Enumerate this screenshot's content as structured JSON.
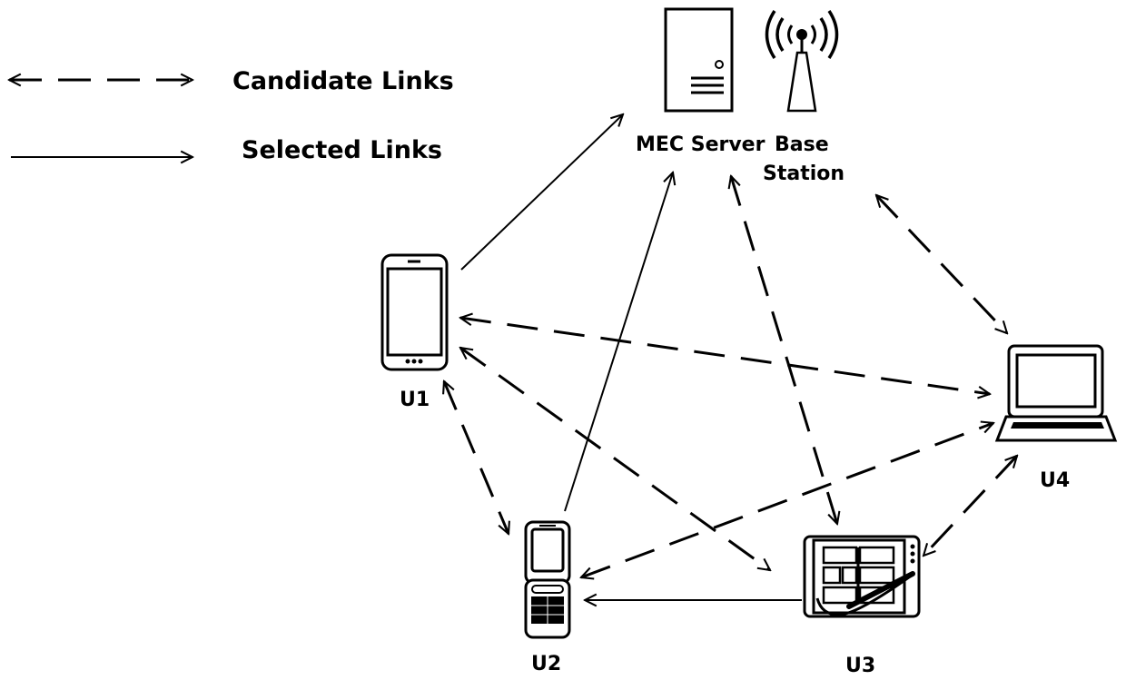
{
  "legend": {
    "candidate_label": "Candidate Links",
    "selected_label": "Selected Links"
  },
  "nodes": {
    "mec_server": {
      "label": "MEC Server",
      "icon": "server-icon"
    },
    "base_station": {
      "label_line1": "Base",
      "label_line2": "Station",
      "icon": "antenna-tower-icon"
    },
    "u1": {
      "label": "U1",
      "icon": "smartphone-icon"
    },
    "u2": {
      "label": "U2",
      "icon": "flip-phone-icon"
    },
    "u3": {
      "label": "U3",
      "icon": "tablet-stylus-icon"
    },
    "u4": {
      "label": "U4",
      "icon": "laptop-icon"
    }
  },
  "links": [
    {
      "from": "U1",
      "to": "MEC Server",
      "type": "selected"
    },
    {
      "from": "U2",
      "to": "MEC Server",
      "type": "selected"
    },
    {
      "from": "U3",
      "to": "U2",
      "type": "selected"
    },
    {
      "from": "U1",
      "to": "U4",
      "type": "candidate"
    },
    {
      "from": "U1",
      "to": "U3",
      "type": "candidate"
    },
    {
      "from": "U1",
      "to": "U2",
      "type": "candidate"
    },
    {
      "from": "MEC Server",
      "to": "U3",
      "type": "candidate"
    },
    {
      "from": "Base Station",
      "to": "U4",
      "type": "candidate"
    },
    {
      "from": "U2",
      "to": "U4",
      "type": "candidate"
    },
    {
      "from": "U4",
      "to": "U3",
      "type": "candidate"
    }
  ]
}
